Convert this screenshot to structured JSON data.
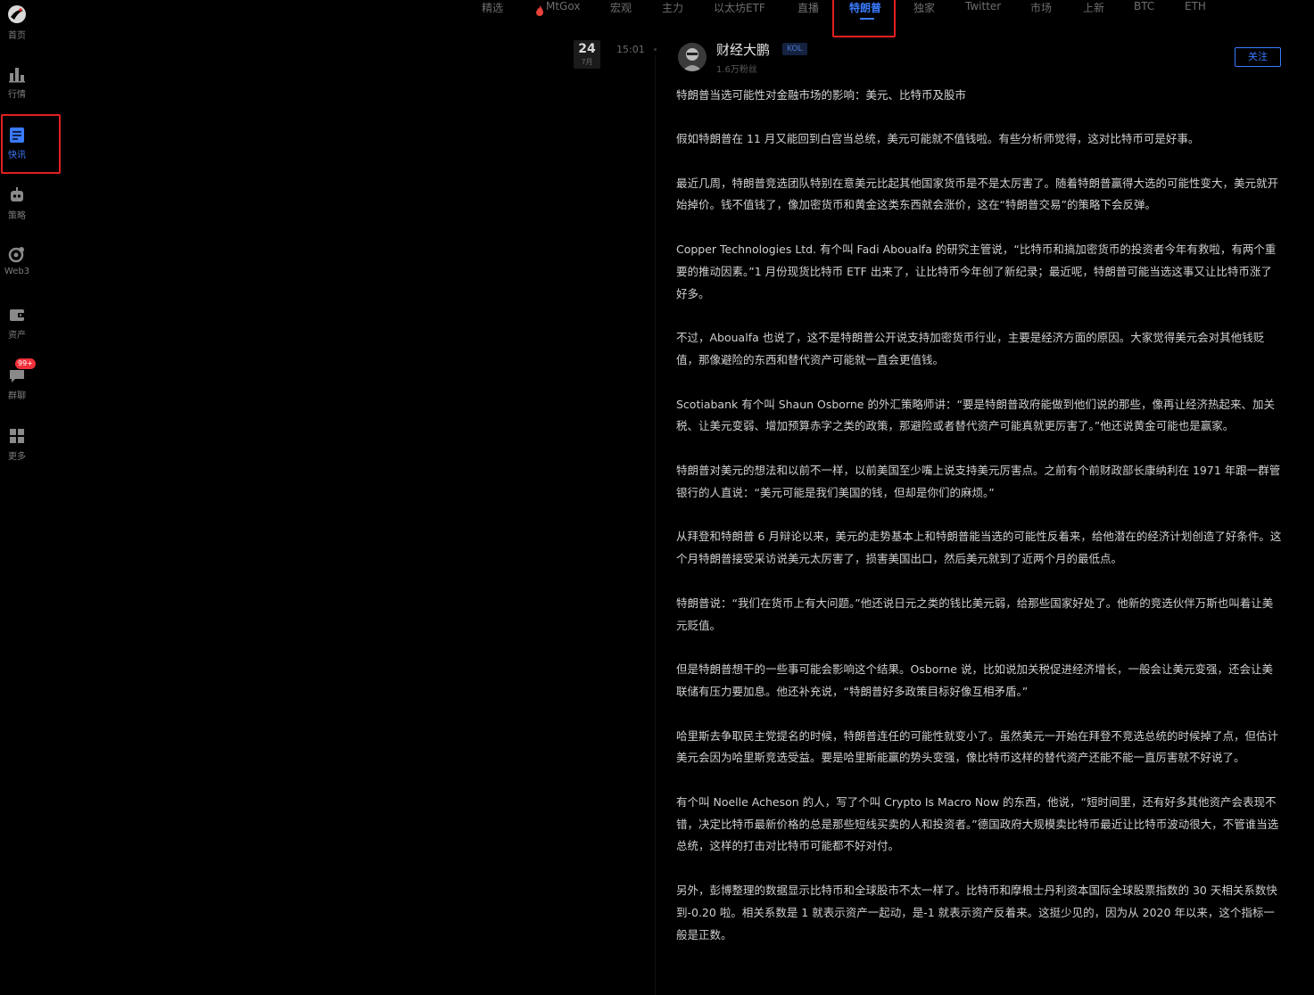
{
  "sidebar": {
    "items": [
      {
        "label": "首页",
        "icon": "home-logo-icon"
      },
      {
        "label": "行情",
        "icon": "bar-chart-icon"
      },
      {
        "label": "快讯",
        "icon": "news-flash-icon"
      },
      {
        "label": "策略",
        "icon": "robot-icon"
      },
      {
        "label": "Web3",
        "icon": "web3-icon"
      },
      {
        "label": "资产",
        "icon": "wallet-icon"
      },
      {
        "label": "群聊",
        "icon": "chat-icon",
        "badge": "99+"
      },
      {
        "label": "更多",
        "icon": "grid-icon"
      }
    ]
  },
  "tabs": [
    "精选",
    "MtGox",
    "宏观",
    "主力",
    "以太坊ETF",
    "直播",
    "特朗普",
    "独家",
    "Twitter",
    "市场",
    "上新",
    "BTC",
    "ETH"
  ],
  "active_tab": "特朗普",
  "timeline": {
    "day": "24",
    "month": "7月",
    "time": "15:01"
  },
  "author": {
    "name": "财经大鹏",
    "badge": "KOL",
    "fans": "1.6万粉丝",
    "follow_label": "关注"
  },
  "article": {
    "title": "特朗普当选可能性对金融市场的影响：美元、比特币及股市",
    "paragraphs": [
      "假如特朗普在 11 月又能回到白宫当总统，美元可能就不值钱啦。有些分析师觉得，这对比特币可是好事。",
      "最近几周，特朗普竞选团队特别在意美元比起其他国家货币是不是太厉害了。随着特朗普赢得大选的可能性变大，美元就开始掉价。钱不值钱了，像加密货币和黄金这类东西就会涨价，这在“特朗普交易”的策略下会反弹。",
      "Copper Technologies Ltd. 有个叫 Fadi Aboualfa 的研究主管说，“比特币和搞加密货币的投资者今年有救啦，有两个重要的推动因素。”1 月份现货比特币 ETF 出来了，让比特币今年创了新纪录；最近呢，特朗普可能当选这事又让比特币涨了好多。",
      "不过，Aboualfa 也说了，这不是特朗普公开说支持加密货币行业，主要是经济方面的原因。大家觉得美元会对其他钱贬值，那像避险的东西和替代资产可能就一直会更值钱。",
      "Scotiabank 有个叫 Shaun Osborne 的外汇策略师讲：“要是特朗普政府能做到他们说的那些，像再让经济热起来、加关税、让美元变弱、增加预算赤字之类的政策，那避险或者替代资产可能真就更厉害了。”他还说黄金可能也是赢家。",
      "特朗普对美元的想法和以前不一样，以前美国至少嘴上说支持美元厉害点。之前有个前财政部长康纳利在 1971 年跟一群管银行的人直说：“美元可能是我们美国的钱，但却是你们的麻烦。”",
      "从拜登和特朗普 6 月辩论以来，美元的走势基本上和特朗普能当选的可能性反着来，给他潜在的经济计划创造了好条件。这个月特朗普接受采访说美元太厉害了，损害美国出口，然后美元就到了近两个月的最低点。",
      "特朗普说：“我们在货币上有大问题。”他还说日元之类的钱比美元弱，给那些国家好处了。他新的竞选伙伴万斯也叫着让美元贬值。",
      "但是特朗普想干的一些事可能会影响这个结果。Osborne 说，比如说加关税促进经济增长，一般会让美元变强，还会让美联储有压力要加息。他还补充说，“特朗普好多政策目标好像互相矛盾。”",
      "哈里斯去争取民主党提名的时候，特朗普连任的可能性就变小了。虽然美元一开始在拜登不竞选总统的时候掉了点，但估计美元会因为哈里斯竞选受益。要是哈里斯能赢的势头变强，像比特币这样的替代资产还能不能一直厉害就不好说了。",
      "有个叫 Noelle Acheson 的人，写了个叫 Crypto Is Macro Now 的东西，他说，“短时间里，还有好多其他资产会表现不错，决定比特币最新价格的总是那些短线买卖的人和投资者。”德国政府大规模卖比特币最近让比特币波动很大，不管谁当选总统，这样的打击对比特币可能都不好对付。",
      "另外，彭博整理的数据显示比特币和全球股市不太一样了。比特币和摩根士丹利资本国际全球股票指数的 30 天相关系数快到-0.20 啦。相关系数是 1 就表示资产一起动，是-1 就表示资产反着来。这挺少见的，因为从 2020 年以来，这个指标一般是正数。"
    ]
  },
  "colors": {
    "background": "#000000",
    "accent": "#3a7bff",
    "highlight_box": "#e02020",
    "badge": "#f0303a"
  }
}
